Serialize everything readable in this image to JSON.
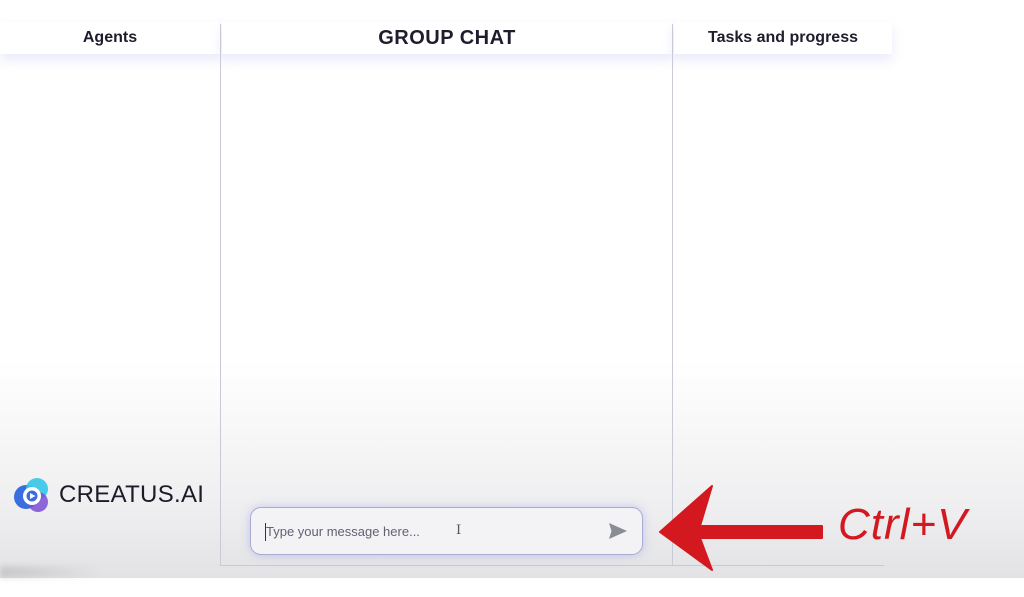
{
  "columns": {
    "agents_title": "Agents",
    "chat_title": "GROUP CHAT",
    "tasks_title": "Tasks and progress"
  },
  "composer": {
    "placeholder": "Type your message here...",
    "value": "",
    "send_icon": "send-icon"
  },
  "logo": {
    "text": "CREATUS.AI",
    "icon": "creatus-logo-icon"
  },
  "annotation": {
    "text": "Ctrl+V",
    "arrow_icon": "left-arrow-icon"
  },
  "colors": {
    "accent_border": "#a9abd4",
    "header_glow": "#7878e6",
    "annotation_red": "#d3191f",
    "logo_blue": "#3a6ee0",
    "logo_cyan": "#35c6e6",
    "logo_purple": "#7b4fd6"
  }
}
